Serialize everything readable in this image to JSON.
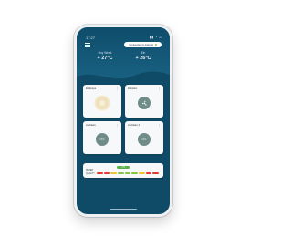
{
  "status_bar": {
    "time": "17:27",
    "icons": "▮▮ ◔ ▭"
  },
  "header": {
    "menu_icon": "menu-icon",
    "connection_label": "Connected to internet",
    "connection_color": "#8bc34a"
  },
  "weather": {
    "outdoor": {
      "label": "Hoy Week",
      "value": "+ 27°C"
    },
    "indoor": {
      "label": "Ein",
      "value": "+ 26°C"
    }
  },
  "cards": [
    {
      "title": "Einlampe",
      "state_icon": "lamp-icon",
      "state_text": ""
    },
    {
      "title": "Filtration",
      "state_icon": "fan-icon",
      "state_text": ""
    },
    {
      "title": "Auxiliaire",
      "state_icon": "power-off-icon",
      "state_text": "OFF"
    },
    {
      "title": "Auxiliaire 2",
      "state_icon": "power-off-icon",
      "state_text": "OFF"
    }
  ],
  "water_quality": {
    "badge": "7.5",
    "label_line1": "WATER",
    "label_line2": "QUALITY",
    "colors": [
      "#e53935",
      "#e53935",
      "#f4c430",
      "#8bc34a",
      "#8bc34a",
      "#8bc34a",
      "#f4c430",
      "#e53935",
      "#e53935"
    ]
  },
  "colors": {
    "screen_bg": "#0f4a66",
    "card_bg": "#f7f8f9",
    "badge_green": "#59b04a"
  }
}
